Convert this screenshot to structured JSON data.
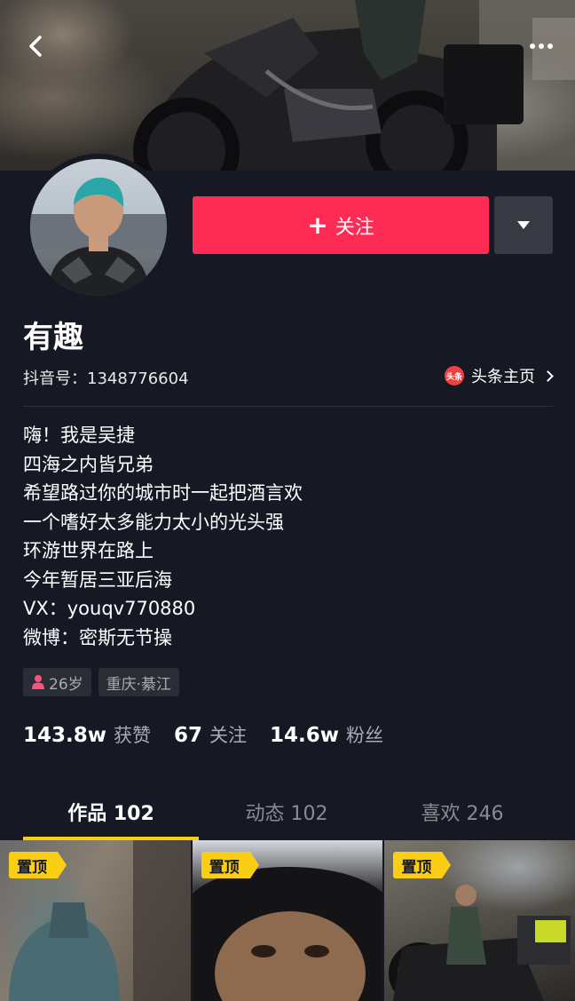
{
  "header": {
    "back_icon": "chevron-left-icon",
    "more_icon": "more-dots-icon"
  },
  "profile": {
    "follow_label": "关注",
    "follow_icon": "plus-icon",
    "dropdown_icon": "triangle-down-icon",
    "nickname": "有趣",
    "douyin_id": "抖音号：1348776604",
    "toutiao_logo": "头条",
    "toutiao_label": "头条主页",
    "bio": [
      "嗨！我是吴捷",
      "四海之内皆兄弟",
      "希望路过你的城市时一起把酒言欢",
      "一个嗜好太多能力太小的光头强",
      "环游世界在路上",
      "今年暂居三亚后海",
      "VX：youqv770880",
      "微博：密斯无节操"
    ],
    "tags": {
      "age": "26岁",
      "location": "重庆·綦江"
    },
    "stats": [
      {
        "num": "143.8w",
        "label": "获赞"
      },
      {
        "num": "67",
        "label": "关注"
      },
      {
        "num": "14.6w",
        "label": "粉丝"
      }
    ]
  },
  "tabs": [
    {
      "label": "作品 102",
      "active": true
    },
    {
      "label": "动态 102",
      "active": false
    },
    {
      "label": "喜欢 246",
      "active": false
    }
  ],
  "grid": [
    {
      "badge": "置顶"
    },
    {
      "badge": "置顶"
    },
    {
      "badge": "置顶"
    }
  ],
  "colors": {
    "background": "#161823",
    "follow_button": "#fe2c55",
    "accent_yellow": "#face15",
    "secondary_text": "#a9abb2"
  }
}
